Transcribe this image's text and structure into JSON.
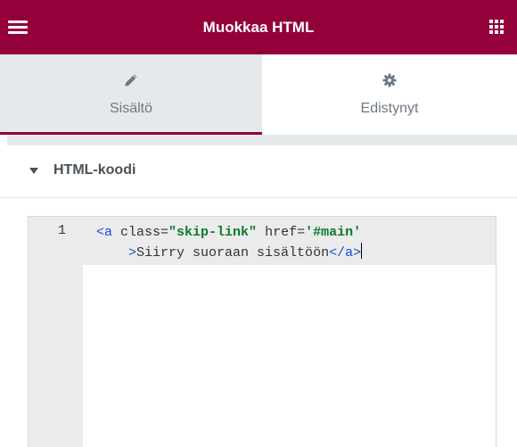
{
  "header": {
    "title": "Muokkaa HTML",
    "menu_icon": "hamburger-icon",
    "apps_icon": "grid-icon"
  },
  "tabs": [
    {
      "label": "Sisältö",
      "icon": "pencil-icon",
      "active": true
    },
    {
      "label": "Edistynyt",
      "icon": "gear-icon",
      "active": false
    }
  ],
  "section": {
    "title": "HTML-koodi",
    "expanded": true
  },
  "editor": {
    "line_number": "1",
    "line1": {
      "open_tag": "<a",
      "class_attr": " class=",
      "class_val": "\"skip-link\"",
      "href_attr": " href=",
      "href_val": "'#main'"
    },
    "line2": {
      "indent": "    ",
      "gt": ">",
      "text": "Siirry suoraan sisältöön",
      "close_tag": "</a>"
    }
  },
  "colors": {
    "brand": "#93003a",
    "tab_active_bg": "#e6e9ec",
    "text_muted": "#6d7882"
  }
}
